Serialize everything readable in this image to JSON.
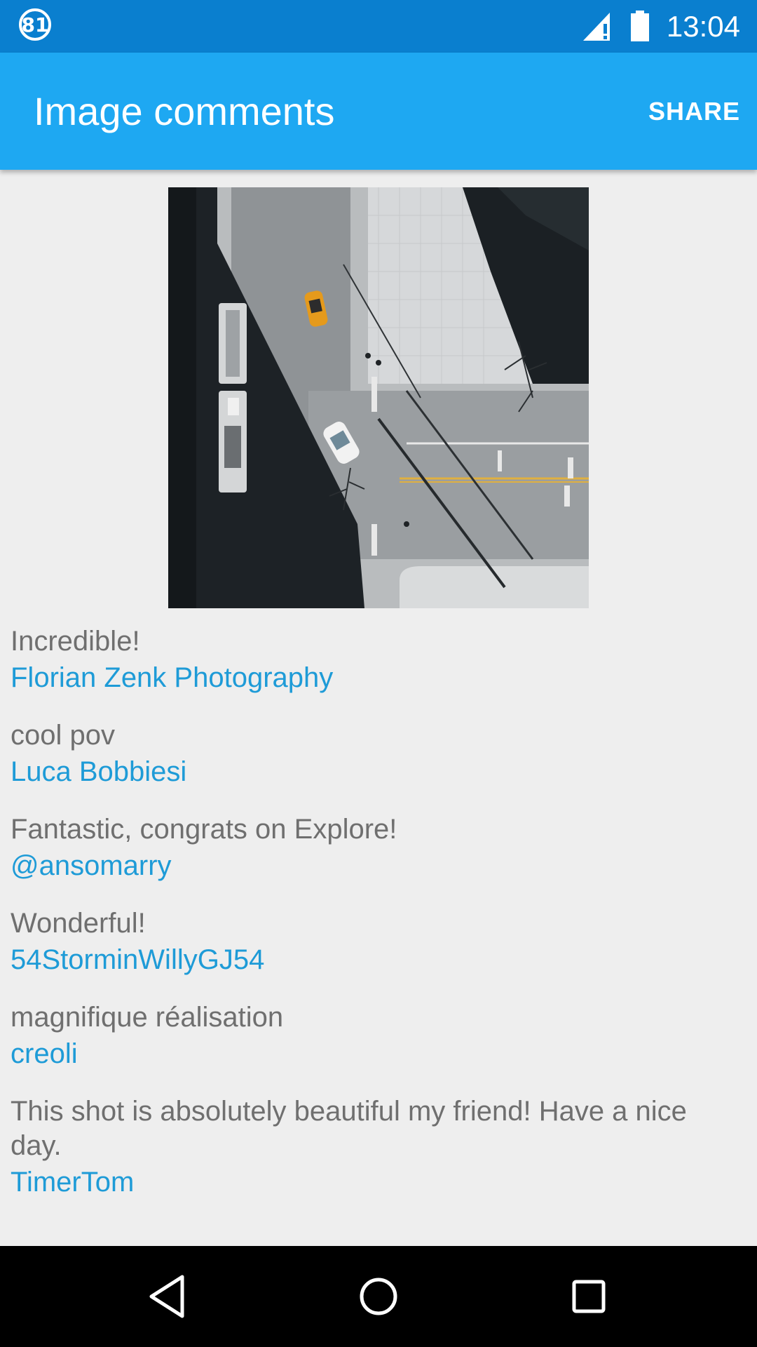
{
  "status_bar": {
    "notification_count": "81",
    "time": "13:04",
    "icons": [
      "signal-icon",
      "battery-icon"
    ]
  },
  "app_bar": {
    "title": "Image comments",
    "share_label": "SHARE"
  },
  "comments": [
    {
      "text": "Incredible!",
      "author": "Florian Zenk Photography"
    },
    {
      "text": "cool pov",
      "author": "Luca Bobbiesi"
    },
    {
      "text": "Fantastic, congrats on Explore!",
      "author": "@ansomarry"
    },
    {
      "text": "Wonderful!",
      "author": "54StorminWillyGJ54"
    },
    {
      "text": "magnifique réalisation",
      "author": "creoli"
    },
    {
      "text": "This shot is absolutely beautiful my friend! Have a nice day.",
      "author": "TimerTom"
    }
  ],
  "colors": {
    "status_bar": "#0a7fcf",
    "app_bar": "#1ea8f2",
    "background": "#eeeeee",
    "comment_text": "#6f6f6f",
    "author_link": "#1e9bd7",
    "nav_bar": "#000000"
  }
}
